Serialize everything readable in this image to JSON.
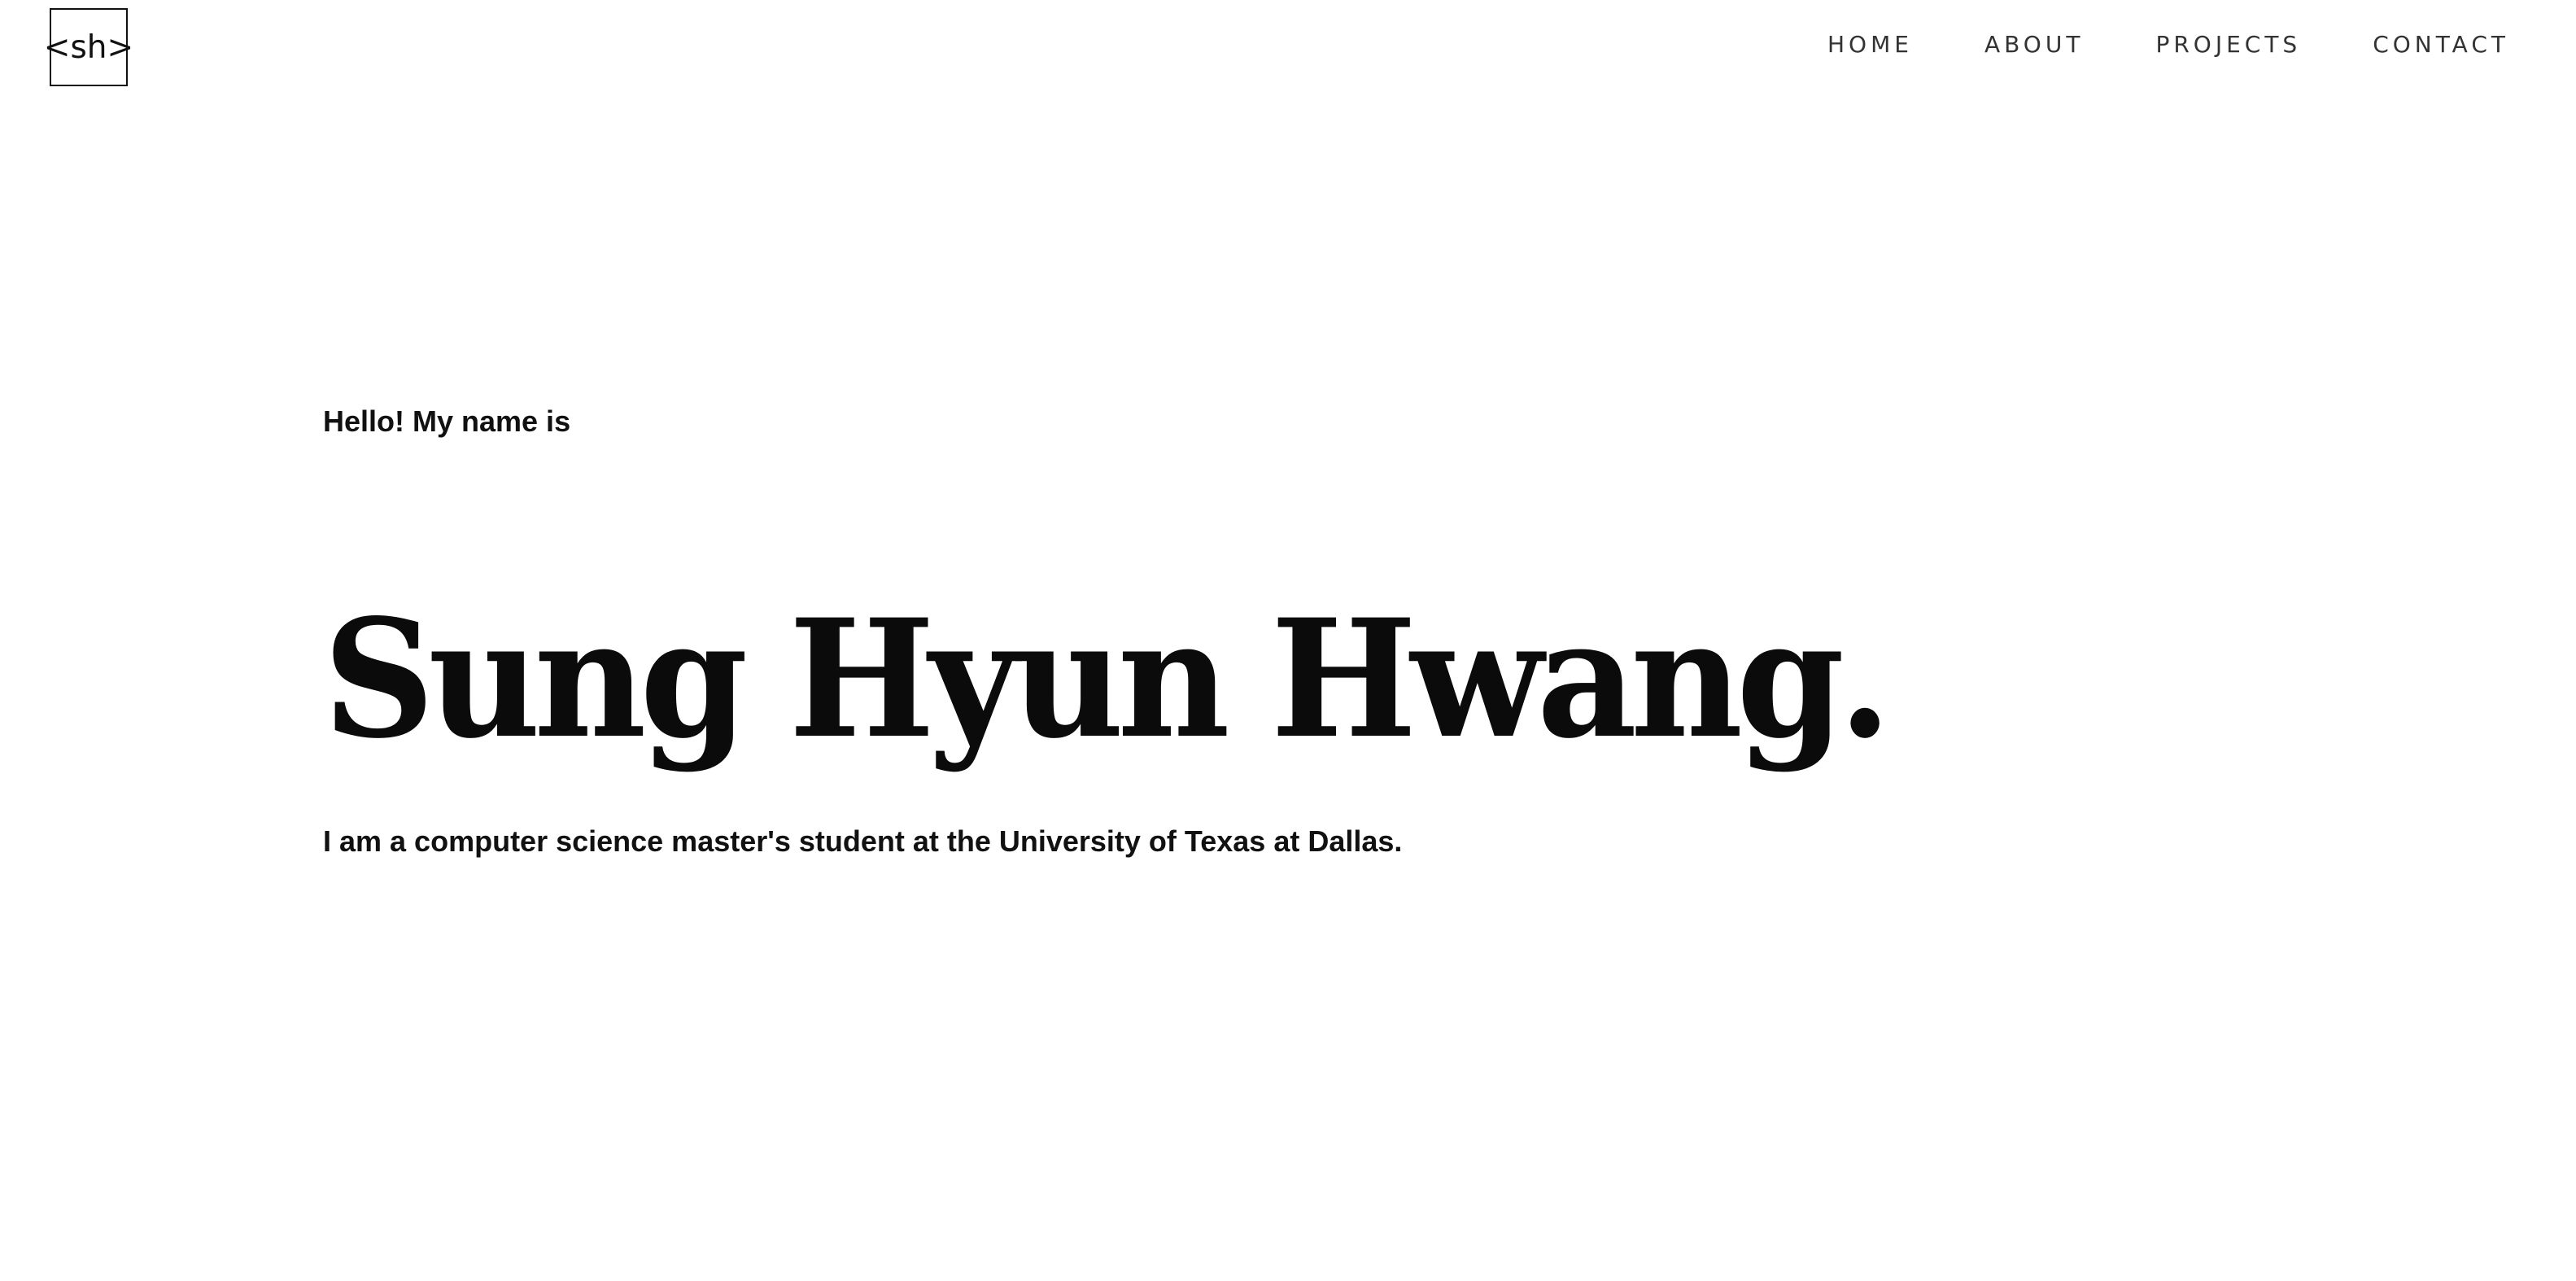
{
  "header": {
    "logo_text": "<sh>",
    "nav": {
      "home": "HOME",
      "about": "ABOUT",
      "projects": "PROJECTS",
      "contact": "CONTACT"
    }
  },
  "hero": {
    "greeting": "Hello! My name is",
    "name": "Sung Hyun Hwang.",
    "intro": "I am a computer science master's student at the University of Texas at Dallas."
  },
  "colors": {
    "background": "#ffffff",
    "text": "#111111",
    "nav_text": "#333333"
  }
}
